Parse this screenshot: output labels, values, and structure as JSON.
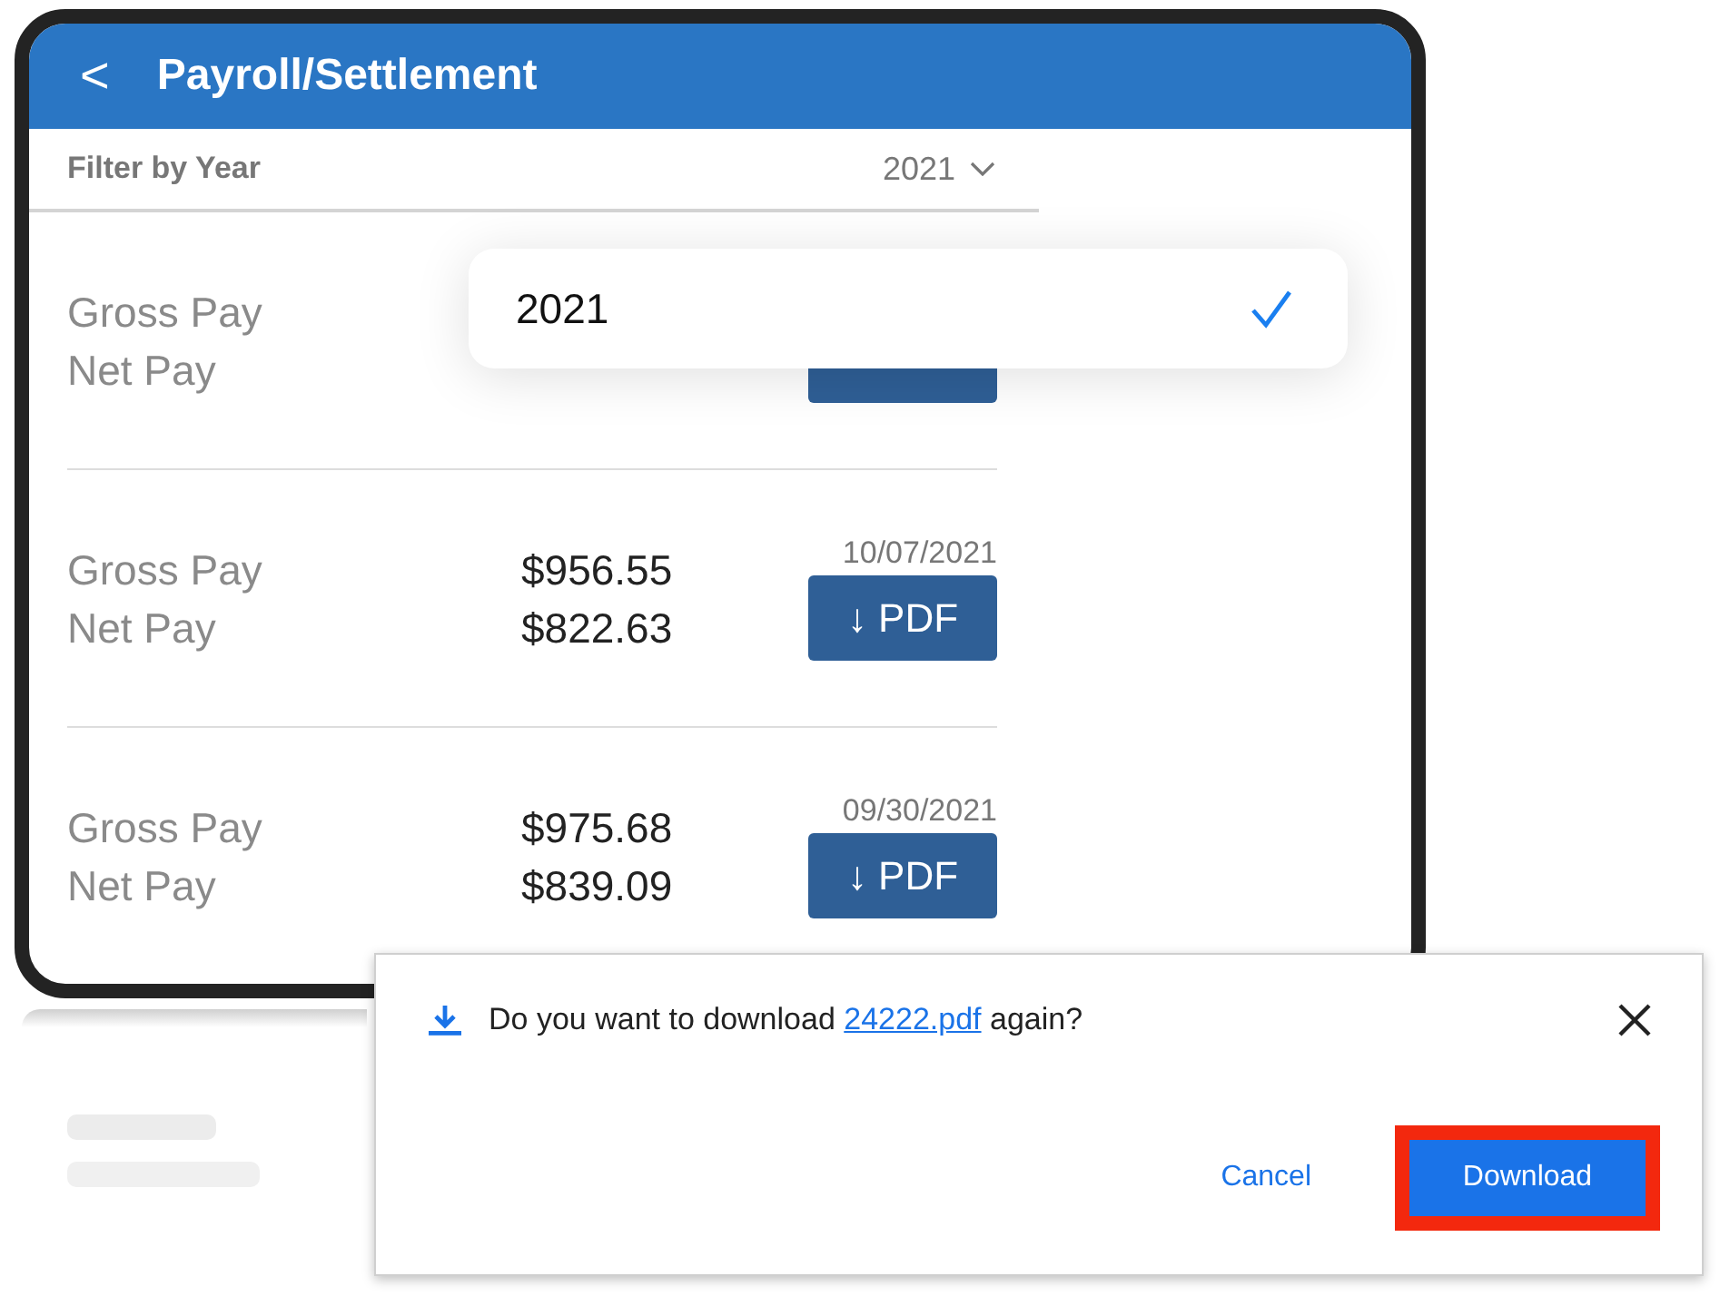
{
  "header": {
    "back": "<",
    "title": "Payroll/Settlement"
  },
  "filter": {
    "label": "Filter by Year",
    "value": "2021"
  },
  "payments": [
    {
      "gross_label": "Gross Pay",
      "net_label": "Net Pay"
    },
    {
      "gross_label": "Gross Pay",
      "net_label": "Net Pay",
      "gross": "$956.55",
      "net": "$822.63",
      "date": "10/07/2021",
      "button": "↓ PDF"
    },
    {
      "gross_label": "Gross Pay",
      "net_label": "Net Pay",
      "gross": "$975.68",
      "net": "$839.09",
      "date": "09/30/2021",
      "button": "↓ PDF"
    }
  ],
  "year_options": [
    {
      "label": "2021",
      "selected": true
    }
  ],
  "download_prompt": {
    "before": "Do you want to download",
    "link": "24222.pdf",
    "after": "again?",
    "cancel": "Cancel",
    "confirm": "Download",
    "confirm_highlighted": true
  }
}
